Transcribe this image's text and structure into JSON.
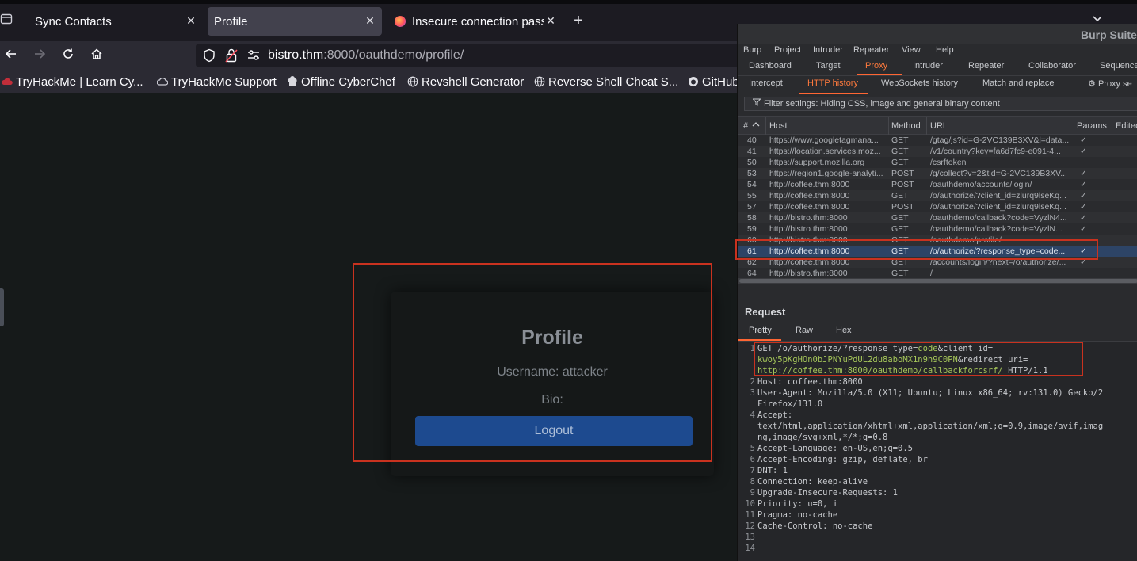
{
  "browser": {
    "tabs": [
      {
        "title": "Sync Contacts"
      },
      {
        "title": "Profile"
      },
      {
        "title": "Insecure connection pass"
      }
    ],
    "url": {
      "host": "bistro.thm",
      "rest": ":8000/oauthdemo/profile/"
    },
    "bookmarks": [
      "TryHackMe | Learn Cy...",
      "TryHackMe Support",
      "Offline CyberChef",
      "Revshell Generator",
      "Reverse Shell Cheat S...",
      "GitHub"
    ]
  },
  "page": {
    "heading": "Profile",
    "username": "Username: attacker",
    "bio": "Bio:",
    "logout": "Logout"
  },
  "burp": {
    "title": "Burp Suite",
    "menu": [
      "Burp",
      "Project",
      "Intruder",
      "Repeater",
      "View",
      "Help"
    ],
    "top_tabs": [
      "Dashboard",
      "Target",
      "Proxy",
      "Intruder",
      "Repeater",
      "Collaborator",
      "Sequence"
    ],
    "sub_tabs": [
      "Intercept",
      "HTTP history",
      "WebSockets history",
      "Match and replace",
      "Proxy se"
    ],
    "filter": "Filter settings: Hiding CSS, image and general binary content",
    "columns": [
      "#",
      "Host",
      "Method",
      "URL",
      "Params",
      "Edited"
    ],
    "sort_icon": "sort-ascending-icon",
    "rows": [
      {
        "num": "40",
        "host": "https://www.googletagmana...",
        "method": "GET",
        "url": "/gtag/js?id=G-2VC139B3XV&l=data...",
        "params": "✓"
      },
      {
        "num": "41",
        "host": "https://location.services.moz...",
        "method": "GET",
        "url": "/v1/country?key=fa6d7fc9-e091-4...",
        "params": "✓"
      },
      {
        "num": "50",
        "host": "https://support.mozilla.org",
        "method": "GET",
        "url": "/csrftoken",
        "params": ""
      },
      {
        "num": "53",
        "host": "https://region1.google-analyti...",
        "method": "POST",
        "url": "/g/collect?v=2&tid=G-2VC139B3XV...",
        "params": "✓"
      },
      {
        "num": "54",
        "host": "http://coffee.thm:8000",
        "method": "POST",
        "url": "/oauthdemo/accounts/login/",
        "params": "✓"
      },
      {
        "num": "55",
        "host": "http://coffee.thm:8000",
        "method": "GET",
        "url": "/o/authorize/?client_id=zlurq9lseKq...",
        "params": "✓"
      },
      {
        "num": "57",
        "host": "http://coffee.thm:8000",
        "method": "POST",
        "url": "/o/authorize/?client_id=zlurq9lseKq...",
        "params": "✓"
      },
      {
        "num": "58",
        "host": "http://bistro.thm:8000",
        "method": "GET",
        "url": "/oauthdemo/callback?code=VyzlN4...",
        "params": "✓"
      },
      {
        "num": "59",
        "host": "http://bistro.thm:8000",
        "method": "GET",
        "url": "/oauthdemo/callback?code=VyzlN...",
        "params": "✓"
      },
      {
        "num": "60",
        "host": "http://bistro.thm:8000",
        "method": "GET",
        "url": "/oauthdemo/profile/",
        "params": ""
      },
      {
        "num": "61",
        "host": "http://coffee.thm:8000",
        "method": "GET",
        "url": "/o/authorize/?response_type=code...",
        "params": "✓"
      },
      {
        "num": "62",
        "host": "http://coffee.thm:8000",
        "method": "GET",
        "url": "/accounts/login/?next=/o/authorize/...",
        "params": "✓"
      },
      {
        "num": "64",
        "host": "http://bistro.thm:8000",
        "method": "GET",
        "url": "/",
        "params": ""
      }
    ],
    "selected_row": "61",
    "request_title": "Request",
    "request_tabs": [
      "Pretty",
      "Raw",
      "Hex"
    ],
    "request_lines": [
      {
        "n": "1",
        "parts": [
          [
            "GET /o/authorize/?response_type=",
            ""
          ],
          [
            "code",
            "v"
          ],
          [
            "&client_id=",
            ""
          ]
        ]
      },
      {
        "n": "",
        "parts": [
          [
            "kwoy5pKgHOn0bJPNYuPdUL2du8aboMX1n9h9C0PN",
            "v"
          ],
          [
            "&redirect_uri=",
            ""
          ]
        ]
      },
      {
        "n": "",
        "parts": [
          [
            "http://coffee.thm:8000/oauthdemo/callbackforcsrf/",
            "v"
          ],
          [
            " HTTP/1.1",
            ""
          ]
        ]
      },
      {
        "n": "2",
        "parts": [
          [
            "Host: coffee.thm:8000",
            ""
          ]
        ]
      },
      {
        "n": "3",
        "parts": [
          [
            "User-Agent: Mozilla/5.0 (X11; Ubuntu; Linux x86_64; rv:131.0) Gecko/2",
            ""
          ]
        ]
      },
      {
        "n": "",
        "parts": [
          [
            "Firefox/131.0",
            ""
          ]
        ]
      },
      {
        "n": "4",
        "parts": [
          [
            "Accept:",
            ""
          ]
        ]
      },
      {
        "n": "",
        "parts": [
          [
            "text/html,application/xhtml+xml,application/xml;q=0.9,image/avif,imag",
            ""
          ]
        ]
      },
      {
        "n": "",
        "parts": [
          [
            "ng,image/svg+xml,*/*;q=0.8",
            ""
          ]
        ]
      },
      {
        "n": "5",
        "parts": [
          [
            "Accept-Language: en-US,en;q=0.5",
            ""
          ]
        ]
      },
      {
        "n": "6",
        "parts": [
          [
            "Accept-Encoding: gzip, deflate, br",
            ""
          ]
        ]
      },
      {
        "n": "7",
        "parts": [
          [
            "DNT: 1",
            ""
          ]
        ]
      },
      {
        "n": "8",
        "parts": [
          [
            "Connection: keep-alive",
            ""
          ]
        ]
      },
      {
        "n": "9",
        "parts": [
          [
            "Upgrade-Insecure-Requests: 1",
            ""
          ]
        ]
      },
      {
        "n": "10",
        "parts": [
          [
            "Priority: u=0, i",
            ""
          ]
        ]
      },
      {
        "n": "11",
        "parts": [
          [
            "Pragma: no-cache",
            ""
          ]
        ]
      },
      {
        "n": "12",
        "parts": [
          [
            "Cache-Control: no-cache",
            ""
          ]
        ]
      },
      {
        "n": "13",
        "parts": [
          [
            "",
            ""
          ]
        ]
      },
      {
        "n": "14",
        "parts": [
          [
            "",
            ""
          ]
        ]
      }
    ]
  },
  "colors": {
    "highlight": "#c9321f",
    "burp_accent": "#ff6633",
    "logout_button": "#1d4a8f"
  }
}
